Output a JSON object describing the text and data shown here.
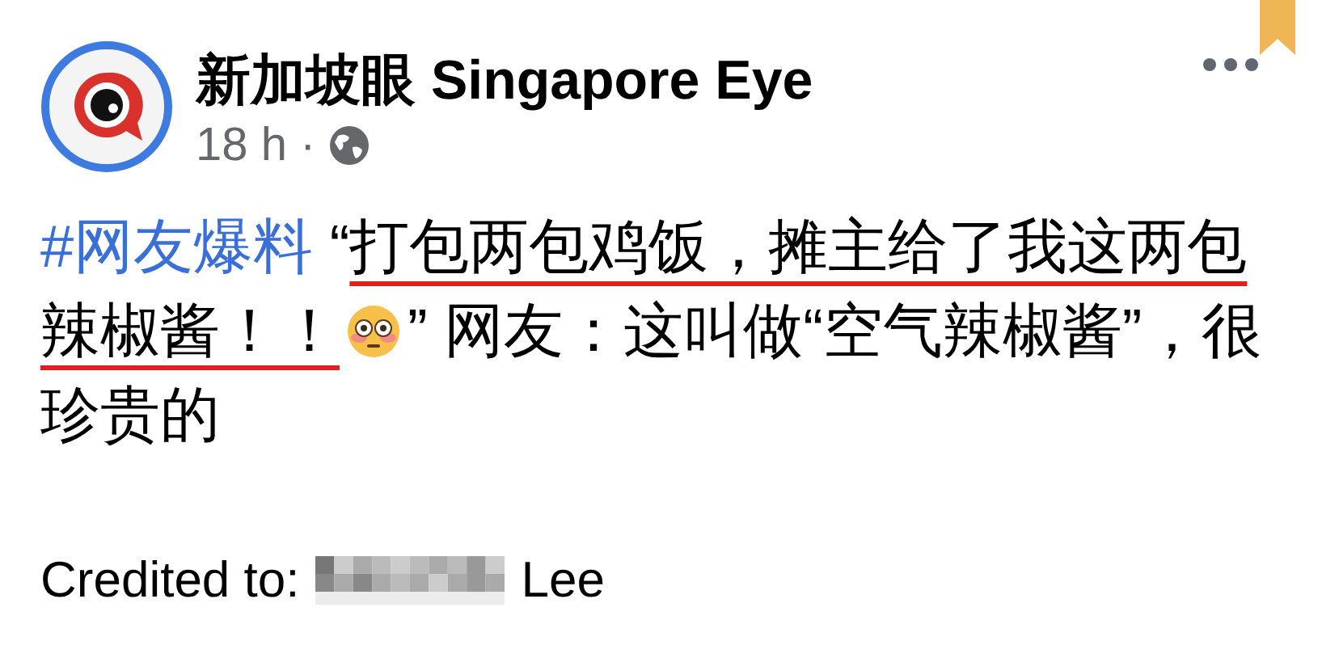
{
  "post": {
    "page_name": "新加坡眼 Singapore Eye",
    "time": "18 h",
    "separator": "·",
    "bookmarked": true,
    "body": [
      {
        "kind": "hashtag",
        "text": "#网友爆料"
      },
      {
        "kind": "text",
        "text": " “"
      },
      {
        "kind": "underlined",
        "text": "打包两包鸡饭，摊主给了我这两包辣椒酱！！"
      },
      {
        "kind": "emoji"
      },
      {
        "kind": "text",
        "text": "” 网友：这叫做“空气辣椒酱”，很珍贵的"
      }
    ],
    "credit": {
      "label": "Credited to:",
      "name_redacted": true,
      "name_end": "Lee"
    }
  }
}
